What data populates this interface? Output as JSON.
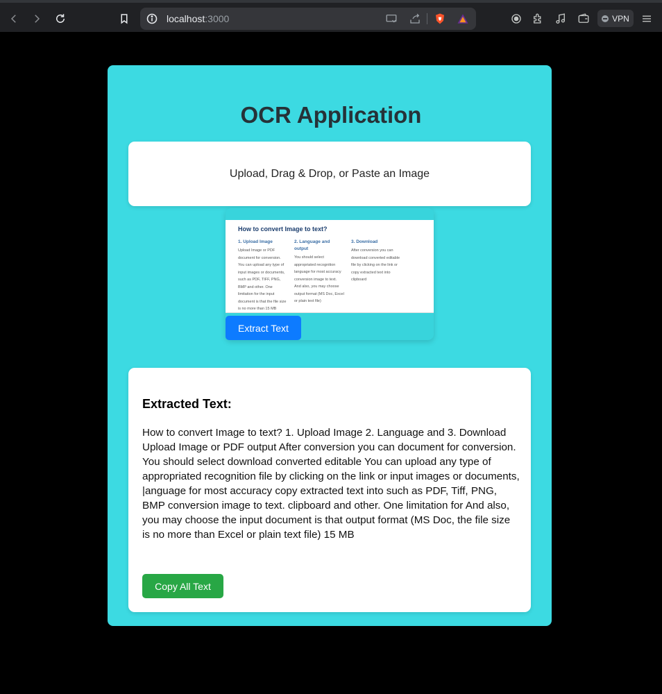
{
  "browser": {
    "url_host": "localhost",
    "url_port": ":3000",
    "vpn_label": "VPN"
  },
  "app": {
    "title": "OCR Application",
    "upload_prompt": "Upload, Drag & Drop, or Paste an Image",
    "preview": {
      "title": "How to convert Image to text?",
      "columns": [
        {
          "heading": "1. Upload Image",
          "body": "Upload Image or PDF document for conversion. You can upload any type of input images or documents, such as PDF, TIFF, PNG, BMP and other. One limitation for the input document is that the file size is no more than 15 MB"
        },
        {
          "heading": "2. Language and output",
          "body": "You should select appropriated recognition language for most accuracy conversion image to text. And also, you may choose output format (MS Doc, Excel or plain text file)"
        },
        {
          "heading": "3. Download",
          "body": "After conversion you can download converted editable file by clicking on the link or copy extracted text into clipboard"
        }
      ]
    },
    "extract_button": "Extract Text",
    "result_heading": "Extracted Text:",
    "result_text": "How to convert Image to text? 1. Upload Image 2. Language and 3. Download Upload Image or PDF output After conversion you can document for conversion. You should select download converted editable You can upload any type of appropriated recognition file by clicking on the link or input images or documents, |anguage for most accuracy copy extracted text into such as PDF, Tiff, PNG, BMP conversion image to text. clipboard and other. One limitation for And also, you may choose the input document is that output format (MS Doc, the file size is no more than Excel or plain text file) 15 MB",
    "copy_button": "Copy All Text"
  },
  "colors": {
    "app_background": "#3cdae2",
    "extract_button": "#0d7bff",
    "copy_button": "#28a745",
    "title_text": "#263238"
  }
}
